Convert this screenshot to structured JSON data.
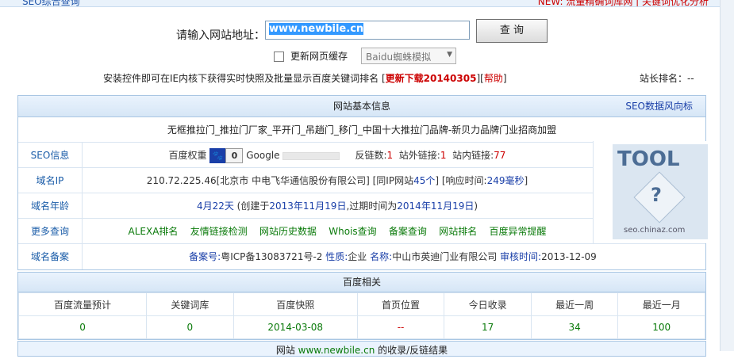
{
  "topbar": {
    "left": "SEO综合查询",
    "right": "NEW: 流量精确词库网 | 关键词优化分析"
  },
  "search": {
    "label": "请输入网站地址：",
    "value": "www.newbile.cn",
    "button": "查 询"
  },
  "options": {
    "cache_label": "更新网页缓存",
    "spider_select": "Baidu蜘蛛模拟"
  },
  "install": {
    "text": "安装控件即可在IE内核下获得实时快照及批量显示百度关键词排名",
    "download": "更新下载20140305",
    "help": "帮助"
  },
  "rank": {
    "label": "站长排名：",
    "value": "--"
  },
  "basic": {
    "title": "网站基本信息",
    "link": "SEO数据风向标",
    "site_title": "无框推拉门_推拉门厂家_平开门_吊趟门_移门_中国十大推拉门品牌-新贝力品牌门业招商加盟",
    "seo": {
      "label": "SEO信息",
      "baidu_weight_label": "百度权重",
      "baidu_weight_icon": "paw-icon",
      "baidu_weight_value": "0",
      "google_label": "Google",
      "backlinks_label": "反链数:",
      "backlinks": "1",
      "external_label": "站外链接:",
      "external": "1",
      "internal_label": "站内链接:",
      "internal": "77"
    },
    "domain_ip": {
      "label": "域名IP",
      "ip": "210.72.225.46",
      "location": "[北京市 中电飞华通信股份有限公司]",
      "same_ip_prefix": "[同IP网站",
      "same_ip_count": "45个",
      "same_ip_suffix": "]",
      "resp_prefix": "[响应时间:",
      "resp_value": "249毫秒",
      "resp_suffix": "]"
    },
    "domain_age": {
      "label": "域名年龄",
      "age": "4月22天",
      "created_prefix": "(创建于",
      "created": "2013年11月19日",
      "expire_prefix": ",过期时间为",
      "expire": "2014年11月19日",
      "suffix": ")"
    },
    "more": {
      "label": "更多查询",
      "links": [
        "ALEXA排名",
        "友情链接检测",
        "网站历史数据",
        "Whois查询",
        "备案查询",
        "网站排名",
        "百度异常提醒"
      ]
    },
    "icp": {
      "label": "域名备案",
      "no_label": "备案号:",
      "no": "粤ICP备13083721号-2",
      "type_label": "性质:",
      "type": "企业",
      "name_label": "名称:",
      "name": "中山市英迪门业有限公司",
      "date_label": "审核时间:",
      "date": "2013-12-09"
    },
    "tool_image": {
      "brand": "TOOL",
      "caption": "seo.chinaz.com"
    }
  },
  "baidu": {
    "title": "百度相关",
    "headers": [
      "百度流量预计",
      "关键词库",
      "百度快照",
      "首页位置",
      "今日收录",
      "最近一周",
      "最近一月"
    ],
    "values": [
      "0",
      "0",
      "2014-03-08",
      "--",
      "17",
      "34",
      "100"
    ]
  },
  "footer": {
    "prefix": "网站",
    "site": "www.newbile.cn",
    "suffix": "的收录/反链结果"
  }
}
